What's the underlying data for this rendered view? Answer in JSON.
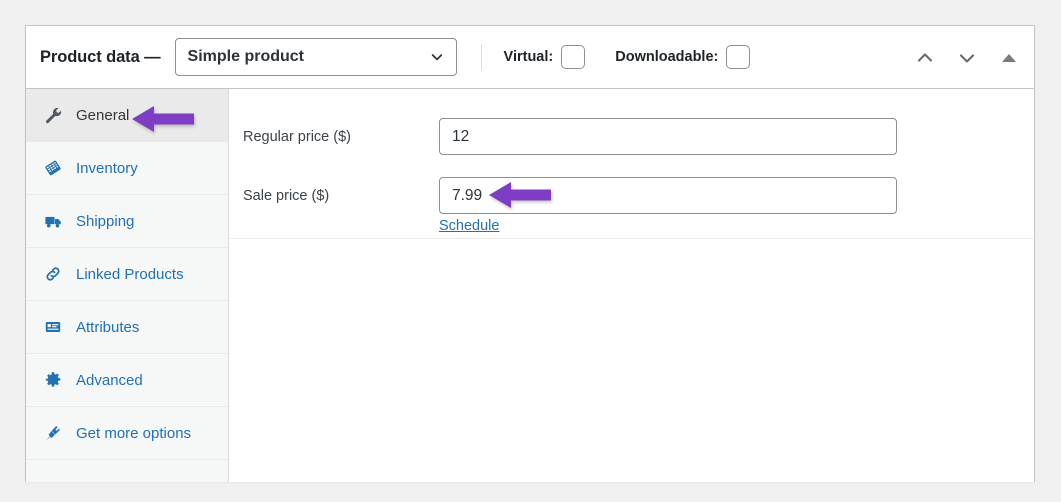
{
  "header": {
    "title": "Product data —",
    "product_type": {
      "selected": "Simple product",
      "chevron_icon": "chevron-down-icon"
    },
    "virtual": {
      "label": "Virtual:",
      "checked": false
    },
    "downloadable": {
      "label": "Downloadable:",
      "checked": false
    },
    "actions": [
      {
        "name": "move-up-button",
        "icon": "chevron-up-icon"
      },
      {
        "name": "move-down-button",
        "icon": "chevron-down-icon"
      },
      {
        "name": "toggle-panel-button",
        "icon": "triangle-up-icon"
      }
    ]
  },
  "tabs": [
    {
      "label": "General",
      "icon": "wrench-icon",
      "active": true
    },
    {
      "label": "Inventory",
      "icon": "archive-box-icon",
      "active": false
    },
    {
      "label": "Shipping",
      "icon": "truck-icon",
      "active": false
    },
    {
      "label": "Linked Products",
      "icon": "link-icon",
      "active": false
    },
    {
      "label": "Attributes",
      "icon": "list-card-icon",
      "active": false
    },
    {
      "label": "Advanced",
      "icon": "gear-icon",
      "active": false
    },
    {
      "label": "Get more options",
      "icon": "plug-icon",
      "active": false
    }
  ],
  "general": {
    "fields": [
      {
        "label": "Regular price ($)",
        "value": "12",
        "placeholder": ""
      },
      {
        "label": "Sale price ($)",
        "value": "7.99",
        "placeholder": ""
      }
    ],
    "schedule_link": "Schedule"
  },
  "annotations": {
    "arrow_color": "#7e3ec3",
    "arrows": [
      {
        "name": "annotation-arrow-general",
        "target": "General tab"
      },
      {
        "name": "annotation-arrow-sale-price",
        "target": "Sale price value"
      }
    ]
  },
  "colors": {
    "page_background": "#f0f0f1",
    "panel_background": "#ffffff",
    "panel_border": "#c3c4c7",
    "link_blue": "#2271b1",
    "active_tab_background": "#eaeaea",
    "sidebar_background": "#f6f7f7",
    "text_dark": "#1d2327",
    "input_border": "#8c8f94"
  }
}
